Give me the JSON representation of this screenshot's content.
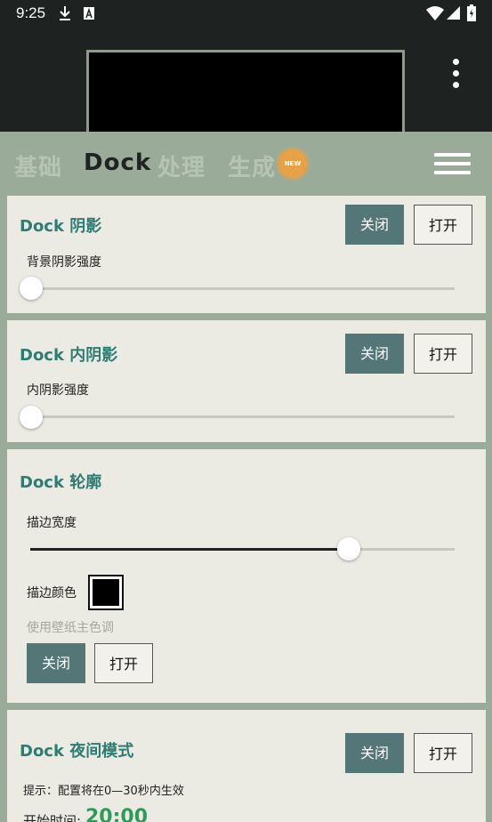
{
  "status_bar": {
    "time": "9:25",
    "icons": [
      "download-icon",
      "a-box-icon",
      "wifi-icon",
      "signal-icon",
      "battery-icon"
    ]
  },
  "tabs": [
    {
      "label": "基础",
      "active": false
    },
    {
      "label": "Dock",
      "active": true
    },
    {
      "label": "处理",
      "active": false
    },
    {
      "label": "生成",
      "active": false
    }
  ],
  "new_badge": "NEW",
  "colors": {
    "accent": "#2f7c74",
    "off_button": "#557677",
    "card_bg": "#ebeae3",
    "background": "#9aab99",
    "badge": "#e7a247"
  },
  "cards": {
    "shadow": {
      "title": "Dock 阴影",
      "off_label": "关闭",
      "on_label": "打开",
      "slider_label": "背景阴影强度",
      "slider_value": 0.0
    },
    "inner_shadow": {
      "title": "Dock 内阴影",
      "off_label": "关闭",
      "on_label": "打开",
      "slider_label": "内阴影强度",
      "slider_value": 0.0
    },
    "outline": {
      "title": "Dock 轮廓",
      "width_label": "描边宽度",
      "width_value": 0.75,
      "color_label": "描边颜色",
      "color_value": "#000000",
      "wallpaper_hint": "使用壁纸主色调",
      "off_label": "关闭",
      "on_label": "打开"
    },
    "night_mode": {
      "title": "Dock 夜间模式",
      "off_label": "关闭",
      "on_label": "打开",
      "tip": "提示：配置将在0—30秒内生效",
      "start_label": "开始时间:",
      "start_value": "20:00"
    }
  }
}
